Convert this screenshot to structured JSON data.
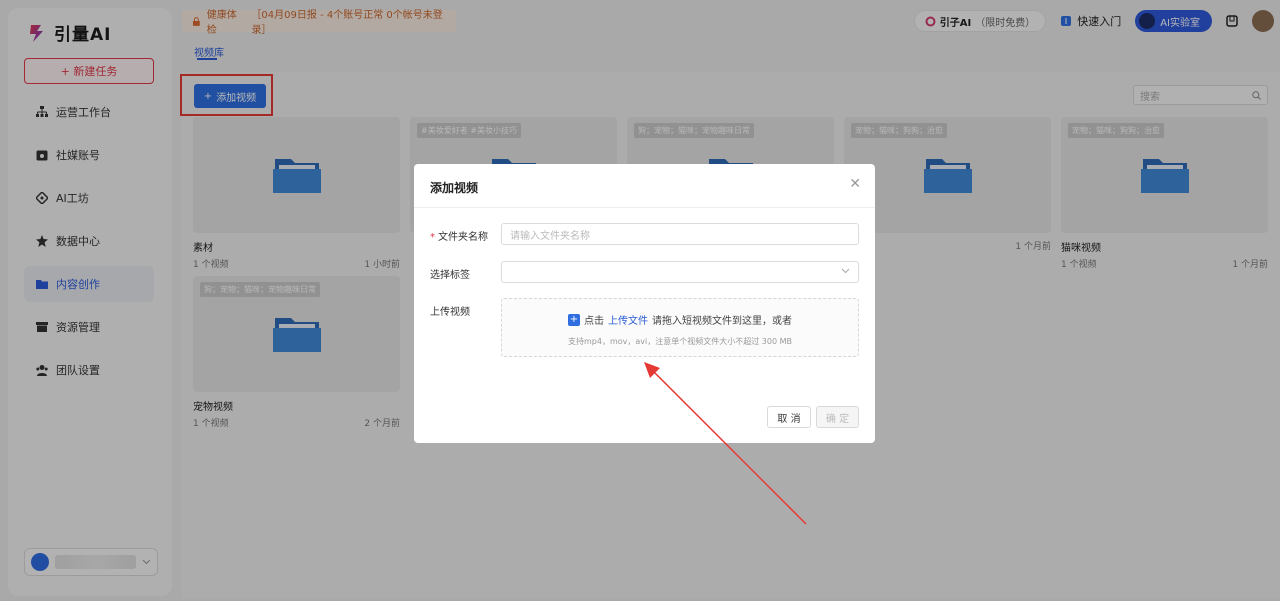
{
  "brand": {
    "name": "引量AI"
  },
  "sidebar": {
    "new_task": "+ 新建任务",
    "items": [
      {
        "label": "运营工作台",
        "icon": "sitemap-icon",
        "active": false
      },
      {
        "label": "社媒账号",
        "icon": "calendar-icon",
        "active": false
      },
      {
        "label": "AI工坊",
        "icon": "ai-diamond-icon",
        "active": false
      },
      {
        "label": "数据中心",
        "icon": "star-icon",
        "active": false
      },
      {
        "label": "内容创作",
        "icon": "folder-icon",
        "active": true
      },
      {
        "label": "资源管理",
        "icon": "archive-icon",
        "active": false
      },
      {
        "label": "团队设置",
        "icon": "team-icon",
        "active": false
      }
    ],
    "user_chevron": "chevron-down-icon"
  },
  "topbar": {
    "notice_label": "健康体检",
    "notice_text": "［04月09日报 - 4个账号正常 0个帐号未登录］",
    "brand_pill_name": "引子AI",
    "brand_pill_note": "（限时免费）",
    "quick_start": "快速入门",
    "ai_lab": "AI实验室"
  },
  "content": {
    "tab": "视频库",
    "add_video": "添加视频",
    "search_placeholder": "搜索",
    "folders": [
      {
        "title": "素材",
        "count": "1 个视频",
        "time": "1 小时前",
        "tag": ""
      },
      {
        "title": "",
        "count": "",
        "time": "",
        "tag": "#美妆爱好者 #美妆小技巧"
      },
      {
        "title": "",
        "count": "",
        "time": "",
        "tag": "狗；宠物；猫咪；宠物趣味日常"
      },
      {
        "title": "",
        "count": "",
        "time": "1 个月前",
        "tag": "宠物；猫咪；狗狗；治愈"
      },
      {
        "title": "猫咪视频",
        "count": "1 个视频",
        "time": "1 个月前",
        "tag": "宠物；猫咪；狗狗；治愈"
      },
      {
        "title": "宠物视频",
        "count": "1 个视频",
        "time": "2 个月前",
        "tag": "狗；宠物；猫咪；宠物趣味日常"
      }
    ]
  },
  "modal": {
    "title": "添加视频",
    "folder_name_label": "文件夹名称",
    "folder_name_placeholder": "请输入文件夹名称",
    "tag_label": "选择标签",
    "upload_label": "上传视频",
    "upload_click": "点击",
    "upload_link": "上传文件",
    "upload_text": "请拖入短视频文件到这里，或者",
    "upload_hint": "支持mp4，mov，avi，注意单个视频文件大小不超过 300 MB",
    "cancel": "取 消",
    "ok": "确 定"
  },
  "colors": {
    "accent": "#2f6ee0",
    "brand_red": "#e0394b",
    "annotation": "#e53935"
  }
}
